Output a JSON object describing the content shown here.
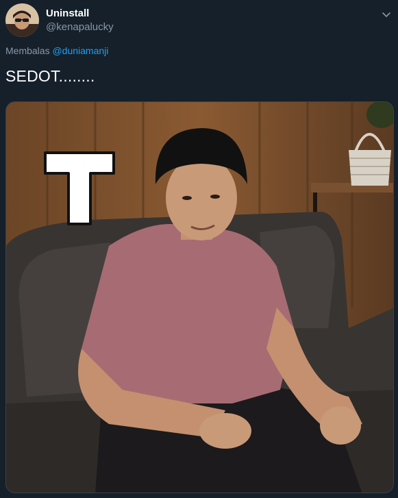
{
  "user": {
    "display_name": "Uninstall",
    "handle": "@kenapalucky"
  },
  "reply": {
    "prefix": "Membalas ",
    "mention": "@duniamanji"
  },
  "tweet": {
    "text": "SEDOT........"
  },
  "media": {
    "overlay_letter": "T"
  },
  "icons": {
    "menu": "chevron-down-icon"
  },
  "colors": {
    "background": "#15202b",
    "secondary_text": "#8899a6",
    "link": "#1da1f2"
  }
}
